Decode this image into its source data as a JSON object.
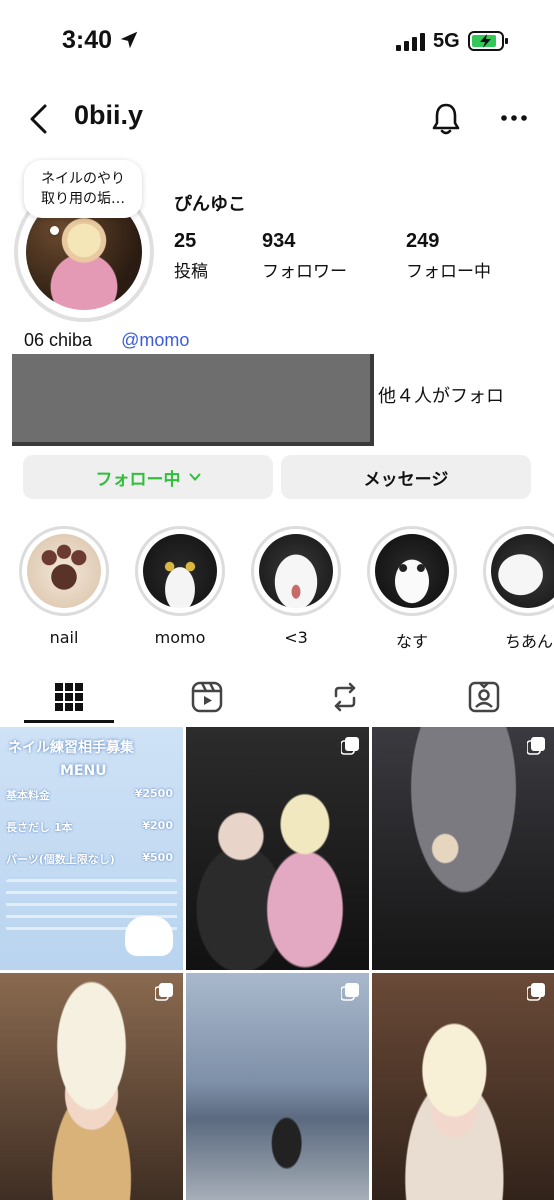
{
  "status_bar": {
    "time": "3:40",
    "network": "5G"
  },
  "header": {
    "username": "0bii.y"
  },
  "profile": {
    "note": "ネイルのやり取り用の垢…",
    "display_name": "ぴんゆこ",
    "stats": [
      {
        "value": "25",
        "label": "投稿"
      },
      {
        "value": "934",
        "label": "フォロワー"
      },
      {
        "value": "249",
        "label": "フォロー中"
      }
    ],
    "bio_text": "06 chiba",
    "bio_mention": "@momo",
    "followed_by_suffix": "、他４人がフォロ"
  },
  "buttons": {
    "following": "フォロー中",
    "message": "メッセージ"
  },
  "highlights": [
    {
      "label": "nail"
    },
    {
      "label": "momo"
    },
    {
      "label": "<3"
    },
    {
      "label": "なす"
    },
    {
      "label": "ちあん"
    }
  ],
  "tabs": [
    {
      "name": "posts",
      "icon": "grid-icon",
      "active": true
    },
    {
      "name": "reels",
      "icon": "reels-icon",
      "active": false
    },
    {
      "name": "reposts",
      "icon": "repost-icon",
      "active": false
    },
    {
      "name": "tagged",
      "icon": "tagged-icon",
      "active": false
    }
  ],
  "menu_post": {
    "title": "ネイル練習相手募集",
    "subtitle": "MENU",
    "lines": [
      {
        "label": "基本料金",
        "price": "¥2500"
      },
      {
        "label": "長さだし 1本",
        "price": "¥200"
      },
      {
        "label": "パーツ(個数上限なし)",
        "price": "¥500"
      }
    ]
  },
  "colors": {
    "mention": "#3b5bdb",
    "following_green": "#2fbf3a"
  }
}
